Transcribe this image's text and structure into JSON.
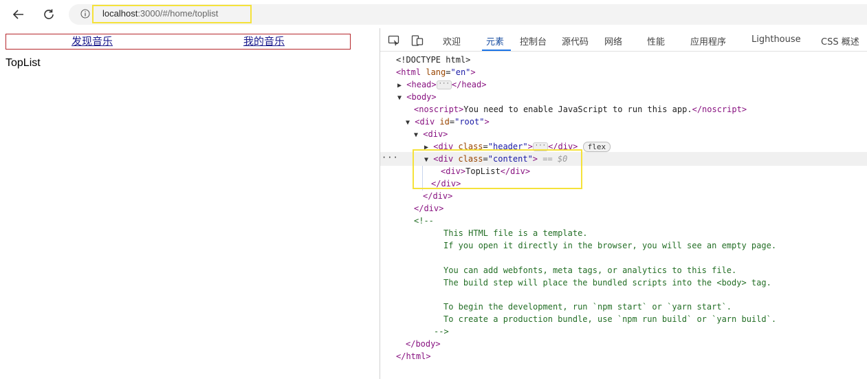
{
  "browser": {
    "url_host": "localhost",
    "url_rest": ":3000/#/home/toplist",
    "accent_highlight": "#f5e23a"
  },
  "page": {
    "nav": [
      {
        "label": "发现音乐"
      },
      {
        "label": "我的音乐"
      }
    ],
    "content": "TopList",
    "border_color": "#b5262b"
  },
  "devtools": {
    "tabs": [
      {
        "label": "欢迎"
      },
      {
        "label": "元素",
        "active": true
      },
      {
        "label": "控制台"
      },
      {
        "label": "源代码"
      },
      {
        "label": "网络"
      },
      {
        "label": "性能"
      },
      {
        "label": "应用程序"
      },
      {
        "label": "Lighthouse"
      },
      {
        "label": "CSS 概述"
      }
    ],
    "dom": {
      "doctype": "<!DOCTYPE html>",
      "html_open_tag": "<html",
      "lang_attr": "lang",
      "lang_value": "\"en\"",
      "head_open": "<head>",
      "head_close": "</head>",
      "body_open": "<body>",
      "noscript_open": "<noscript>",
      "noscript_text": "You need to enable JavaScript to run this app.",
      "noscript_close": "</noscript>",
      "div_open": "<div",
      "id_attr": "id",
      "root_value": "\"root\"",
      "div_plain": "<div>",
      "class_attr": "class",
      "header_value": "\"header\"",
      "div_close": "</div>",
      "flex_badge": "flex",
      "content_value": "\"content\"",
      "selected_marker": "== $0",
      "toplist_text": "TopList",
      "comment_open": "<!--",
      "comment_lines": [
        "This HTML file is a template.",
        "If you open it directly in the browser, you will see an empty page.",
        "",
        "You can add webfonts, meta tags, or analytics to this file.",
        "The build step will place the bundled scripts into the <body> tag.",
        "",
        "To begin the development, run `npm start` or `yarn start`.",
        "To create a production bundle, use `npm run build` or `yarn build`."
      ],
      "comment_close": "-->",
      "body_close": "</body>",
      "html_close": "</html>"
    }
  }
}
